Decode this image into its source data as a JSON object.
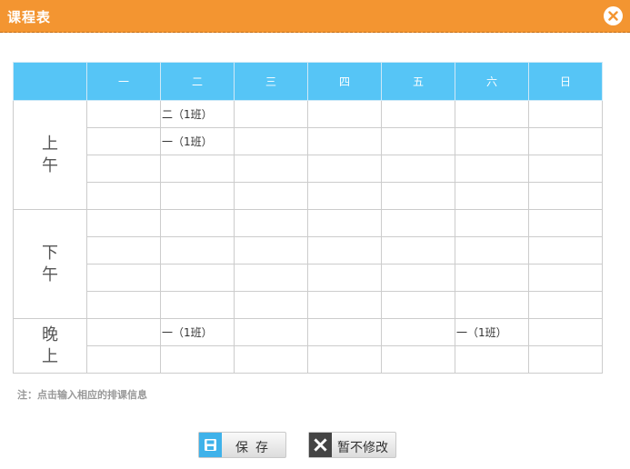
{
  "dialog": {
    "title": "课程表"
  },
  "schedule": {
    "days": [
      "一",
      "二",
      "三",
      "四",
      "五",
      "六",
      "日"
    ],
    "periods": [
      {
        "label_lines": [
          "上",
          "午"
        ],
        "rows": [
          [
            "",
            "二（1班）",
            "",
            "",
            "",
            "",
            ""
          ],
          [
            "",
            "一（1班）",
            "",
            "",
            "",
            "",
            ""
          ],
          [
            "",
            "",
            "",
            "",
            "",
            "",
            ""
          ],
          [
            "",
            "",
            "",
            "",
            "",
            "",
            ""
          ]
        ]
      },
      {
        "label_lines": [
          "下",
          "午"
        ],
        "rows": [
          [
            "",
            "",
            "",
            "",
            "",
            "",
            ""
          ],
          [
            "",
            "",
            "",
            "",
            "",
            "",
            ""
          ],
          [
            "",
            "",
            "",
            "",
            "",
            "",
            ""
          ],
          [
            "",
            "",
            "",
            "",
            "",
            "",
            ""
          ]
        ]
      },
      {
        "label_lines": [
          "晚",
          "上"
        ],
        "rows": [
          [
            "",
            "一（1班）",
            "",
            "",
            "",
            "一（1班）",
            ""
          ],
          [
            "",
            "",
            "",
            "",
            "",
            "",
            ""
          ]
        ]
      }
    ]
  },
  "note": "注：点击输入相应的排课信息",
  "buttons": {
    "save_label": "保存",
    "cancel_label": "暂不修改"
  },
  "colors": {
    "titlebar": "#f39531",
    "header": "#56c5f6",
    "save_icon": "#3fb2ea",
    "cancel_icon": "#444444"
  },
  "icons": {
    "close": "close-icon",
    "save": "floppy-disk-icon",
    "cancel": "x-icon"
  }
}
